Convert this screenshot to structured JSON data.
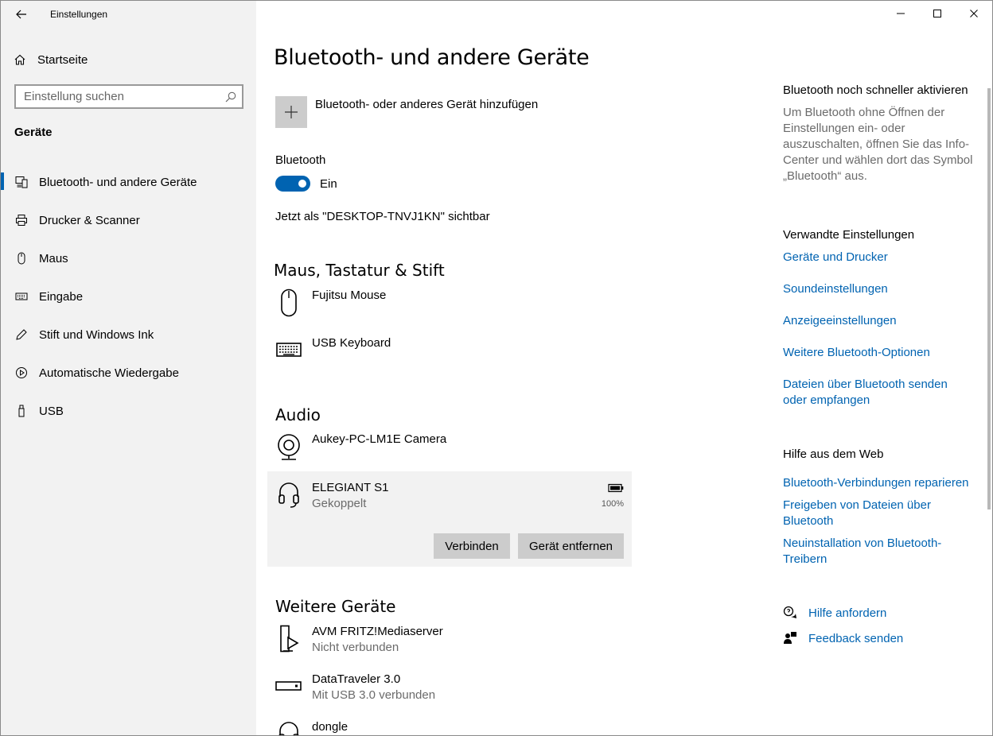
{
  "window": {
    "title": "Einstellungen"
  },
  "sidebar": {
    "home_label": "Startseite",
    "search_placeholder": "Einstellung suchen",
    "section_label": "Geräte",
    "items": [
      {
        "label": "Bluetooth- und andere Geräte",
        "icon": "bluetooth-devices-icon",
        "active": true
      },
      {
        "label": "Drucker & Scanner",
        "icon": "printer-icon",
        "active": false
      },
      {
        "label": "Maus",
        "icon": "mouse-icon",
        "active": false
      },
      {
        "label": "Eingabe",
        "icon": "keyboard-icon",
        "active": false
      },
      {
        "label": "Stift und Windows Ink",
        "icon": "pen-icon",
        "active": false
      },
      {
        "label": "Automatische Wiedergabe",
        "icon": "autoplay-icon",
        "active": false
      },
      {
        "label": "USB",
        "icon": "usb-icon",
        "active": false
      }
    ]
  },
  "main": {
    "title": "Bluetooth- und andere Geräte",
    "add_device_label": "Bluetooth- oder anderes Gerät hinzufügen",
    "bluetooth": {
      "label": "Bluetooth",
      "state": "Ein",
      "visible_text": "Jetzt als \"DESKTOP-TNVJ1KN\" sichtbar"
    },
    "groups": {
      "mouse_keyboard": {
        "title": "Maus, Tastatur & Stift",
        "devices": [
          {
            "name": "Fujitsu Mouse",
            "icon": "mouse-icon"
          },
          {
            "name": "USB Keyboard",
            "icon": "keyboard-icon"
          }
        ]
      },
      "audio": {
        "title": "Audio",
        "devices": [
          {
            "name": "Aukey-PC-LM1E Camera",
            "icon": "webcam-icon"
          },
          {
            "name": "ELEGIANT S1",
            "status": "Gekoppelt",
            "icon": "headset-icon",
            "battery": "100%",
            "selected": true
          }
        ],
        "buttons": {
          "connect": "Verbinden",
          "remove": "Gerät entfernen"
        }
      },
      "other": {
        "title": "Weitere Geräte",
        "devices": [
          {
            "name": "AVM FRITZ!Mediaserver",
            "status": "Nicht verbunden",
            "icon": "media-server-icon"
          },
          {
            "name": "DataTraveler 3.0",
            "status": "Mit USB 3.0 verbunden",
            "icon": "usb-drive-icon"
          },
          {
            "name": "dongle",
            "icon": "headset-icon"
          }
        ]
      }
    }
  },
  "right_pane": {
    "quick_title": "Bluetooth noch schneller aktivieren",
    "quick_desc": "Um Bluetooth ohne Öffnen der Einstellungen ein- oder auszuschalten, öffnen Sie das Info-Center und wählen dort das Symbol „Bluetooth“ aus.",
    "related_title": "Verwandte Einstellungen",
    "related_links": [
      "Geräte und Drucker",
      "Soundeinstellungen",
      "Anzeigeeinstellungen",
      "Weitere Bluetooth-Optionen",
      "Dateien über Bluetooth senden oder empfangen"
    ],
    "web_help_title": "Hilfe aus dem Web",
    "web_help_links": [
      "Bluetooth-Verbindungen reparieren",
      "Freigeben von Dateien über Bluetooth",
      "Neuinstallation von Bluetooth-Treibern"
    ],
    "get_help": "Hilfe anfordern",
    "give_feedback": "Feedback senden"
  },
  "colors": {
    "accent": "#0063b1",
    "sidebar_bg": "#f2f2f2",
    "button_bg": "#cccccc",
    "secondary_text": "#6b6b6b"
  }
}
